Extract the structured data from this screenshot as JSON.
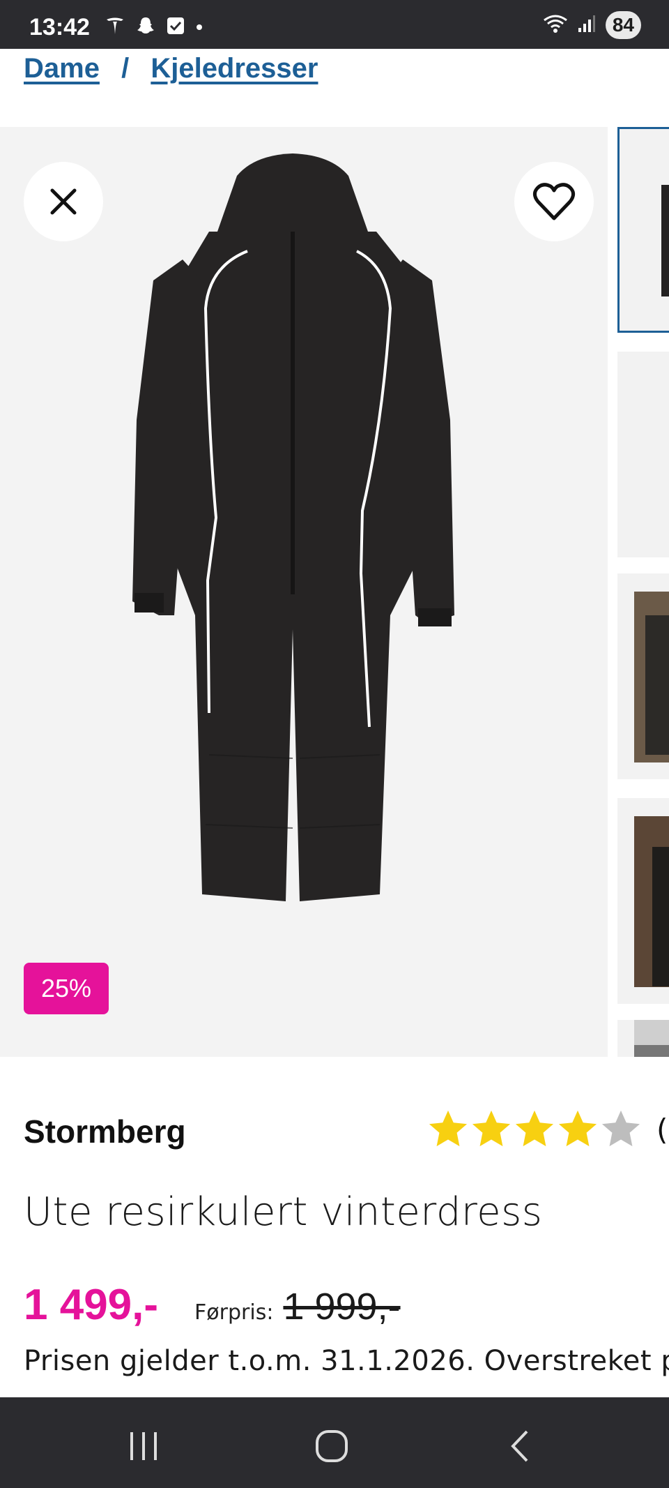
{
  "status": {
    "time": "13:42",
    "battery": "84"
  },
  "breadcrumb": {
    "items": [
      "Dame",
      "Kjeledresser"
    ],
    "separator": "/"
  },
  "gallery": {
    "discount_badge": "25%"
  },
  "product": {
    "brand": "Stormberg",
    "rating_stars": 4,
    "rating_max": 5,
    "reviews_partial": "(",
    "title": "Ute resirkulert vinterdress",
    "price": "1 499,-",
    "prior_label": "Førpris:",
    "prior_price": "1 999,-",
    "price_note": "Prisen gjelder t.o.m. 31.1.2026. Overstreket p",
    "price_note_2": "                                        "
  },
  "colors": {
    "accent": "#e5129a",
    "link": "#1d5f96",
    "star": "#f7d011",
    "star_empty": "#bdbdbd"
  }
}
